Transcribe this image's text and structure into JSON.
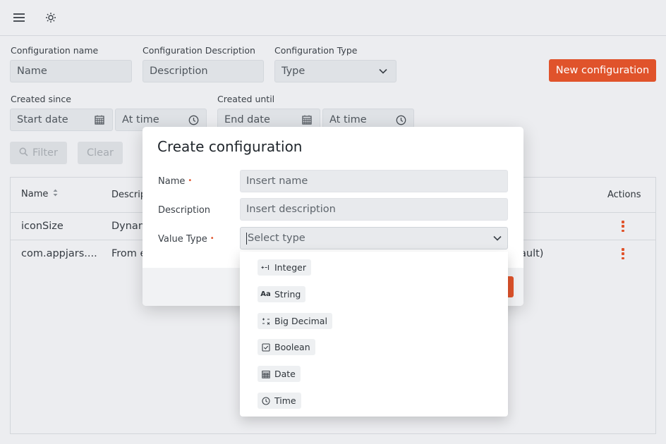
{
  "topbar": {
    "menu_icon": "hamburger-menu-icon",
    "theme_icon": "sun-icon"
  },
  "filters": {
    "config_name": {
      "label": "Configuration name",
      "placeholder": "Name"
    },
    "config_description": {
      "label": "Configuration Description",
      "placeholder": "Description"
    },
    "config_type": {
      "label": "Configuration Type",
      "placeholder": "Type"
    },
    "new_button": "New configuration",
    "created_since": {
      "label": "Created since",
      "date_placeholder": "Start date",
      "time_placeholder": "At time"
    },
    "created_until": {
      "label": "Created until",
      "date_placeholder": "End date",
      "time_placeholder": "At time"
    },
    "filter_button": "Filter",
    "clear_button": "Clear"
  },
  "table": {
    "headers": {
      "name": "Name",
      "description": "Descrip",
      "actions": "Actions"
    },
    "rows": [
      {
        "name": "iconSize",
        "description": "Dynam",
        "extra": ""
      },
      {
        "name": "com.appjars....",
        "description": "From e",
        "extra": "ault)"
      }
    ]
  },
  "modal": {
    "title": "Create configuration",
    "name_label": "Name",
    "name_placeholder": "Insert name",
    "description_label": "Description",
    "description_placeholder": "Insert description",
    "value_type_label": "Value Type",
    "value_type_placeholder": "Select type",
    "required_marker": "•"
  },
  "dropdown": {
    "options": [
      {
        "label": "Integer",
        "icon": "integer-icon"
      },
      {
        "label": "String",
        "icon": "string-icon"
      },
      {
        "label": "Big Decimal",
        "icon": "big-decimal-icon"
      },
      {
        "label": "Boolean",
        "icon": "checkbox-icon"
      },
      {
        "label": "Date",
        "icon": "calendar-icon"
      },
      {
        "label": "Time",
        "icon": "clock-icon"
      }
    ]
  },
  "colors": {
    "accent": "#e0532b",
    "background": "#ecedf0",
    "field": "#dfe2e6"
  }
}
